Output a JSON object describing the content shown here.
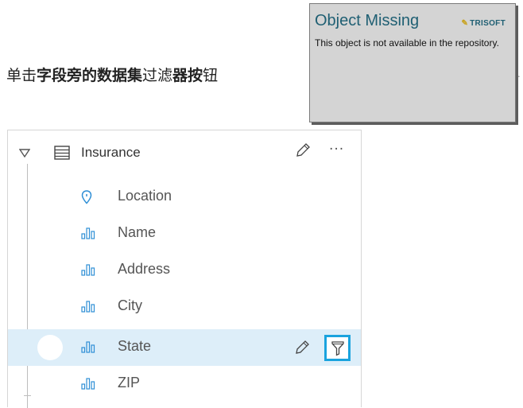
{
  "instruction": {
    "part1": "单击",
    "part2": "字段旁的数据集",
    "part3": "过滤",
    "part4": "器按",
    "part5": "钮",
    "trail": "."
  },
  "missing_object": {
    "title": "Object Missing",
    "logo": "TRISOFT",
    "message": "This object is not available in the repository."
  },
  "dataset": {
    "name": "Insurance",
    "more_label": "···",
    "fields": [
      {
        "label": "Location",
        "icon": "location-pin-icon"
      },
      {
        "label": "Name",
        "icon": "string-field-icon"
      },
      {
        "label": "Address",
        "icon": "string-field-icon"
      },
      {
        "label": "City",
        "icon": "string-field-icon"
      },
      {
        "label": "State",
        "icon": "string-field-icon",
        "selected": true
      },
      {
        "label": "ZIP",
        "icon": "string-field-icon"
      }
    ]
  },
  "colors": {
    "accent": "#1aa3de",
    "selected_row": "#ddeef9",
    "icon_blue": "#2f8fd6"
  }
}
